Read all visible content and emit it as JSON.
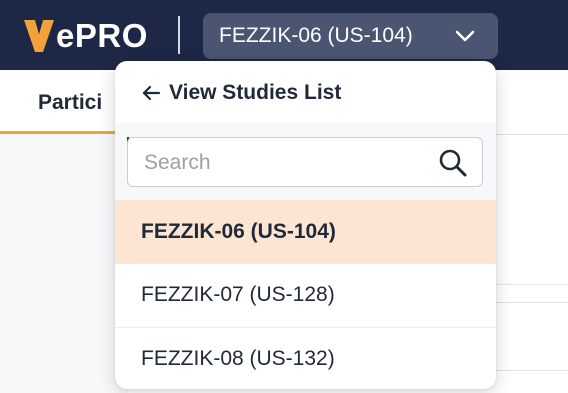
{
  "header": {
    "logo_text": "ePRO",
    "current_study": "FEZZIK-06 (US-104)",
    "chevron_icon": "chevron-down-icon"
  },
  "tabs": [
    {
      "label": "Partici",
      "active": true
    }
  ],
  "dropdown": {
    "back_label": "View Studies List",
    "back_icon": "arrow-left-icon",
    "search": {
      "placeholder": "Search",
      "value": ""
    },
    "studies": [
      {
        "label": "FEZZIK-06 (US-104)",
        "selected": true
      },
      {
        "label": "FEZZIK-07 (US-128)",
        "selected": false
      },
      {
        "label": "FEZZIK-08 (US-132)",
        "selected": false
      }
    ]
  },
  "colors": {
    "header_bg": "#1d2846",
    "accent": "#f3a13b",
    "selected_row": "#fce6d3"
  }
}
